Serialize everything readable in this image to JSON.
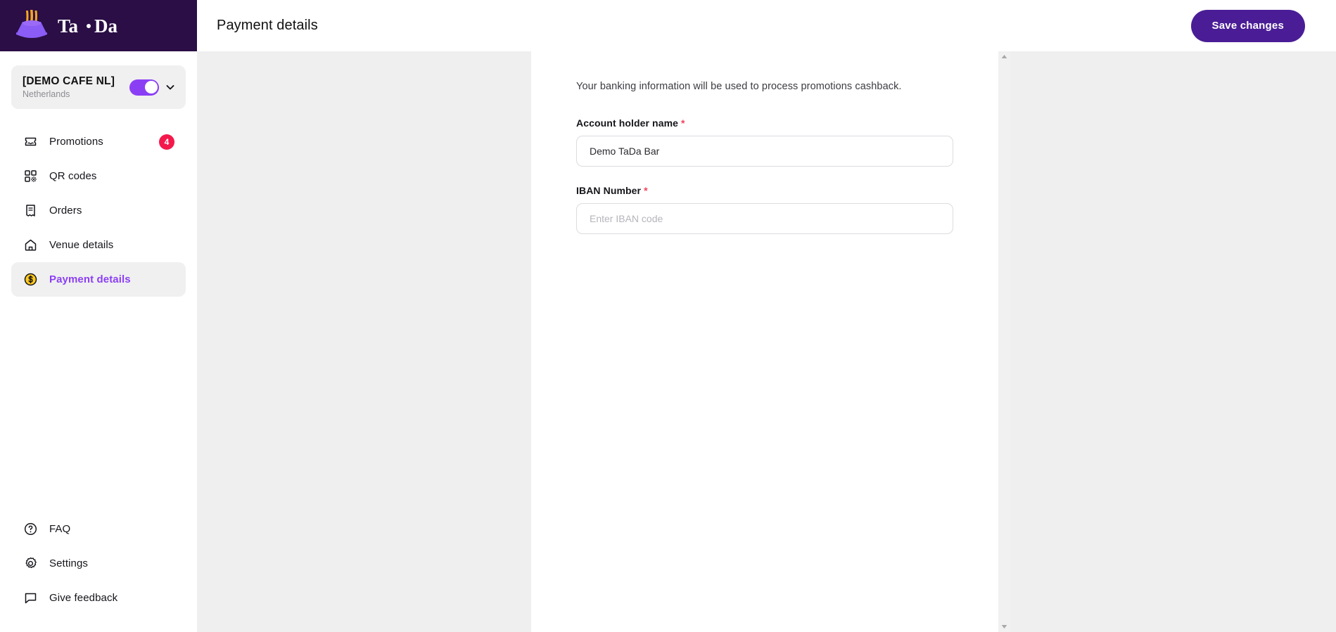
{
  "brand": {
    "logo_icon": "tada-hat-logo-icon",
    "wordmark": "Ta·Da",
    "logo_bar_color": "#2A0E45",
    "accent_purple": "#8B3FF5",
    "deep_purple": "#4A1D96",
    "badge_red": "#F4194B",
    "required_red": "#F4435C"
  },
  "sidebar": {
    "venue_selector": {
      "name": "[DEMO CAFE NL]",
      "country": "Netherlands",
      "toggle_on": true,
      "toggle_icon": "toggle-switch-on-icon",
      "chevron_icon": "chevron-down-icon"
    },
    "items": [
      {
        "label": "Promotions",
        "icon": "ticket-icon",
        "badge": "4",
        "active": false
      },
      {
        "label": "QR codes",
        "icon": "qr-code-icon",
        "badge": null,
        "active": false
      },
      {
        "label": "Orders",
        "icon": "receipt-icon",
        "badge": null,
        "active": false
      },
      {
        "label": "Venue details",
        "icon": "home-icon",
        "badge": null,
        "active": false
      },
      {
        "label": "Payment details",
        "icon": "dollar-coin-icon",
        "badge": null,
        "active": true
      }
    ],
    "bottom_items": [
      {
        "label": "FAQ",
        "icon": "question-circle-icon"
      },
      {
        "label": "Settings",
        "icon": "gear-icon"
      },
      {
        "label": "Give feedback",
        "icon": "chat-bubble-icon"
      }
    ]
  },
  "header": {
    "title": "Payment details",
    "save_label": "Save changes"
  },
  "main": {
    "intro": "Your banking information will be used to process promotions cashback.",
    "fields": [
      {
        "label": "Account holder name",
        "required_mark": "*",
        "value": "Demo TaDa Bar",
        "placeholder": ""
      },
      {
        "label": "IBAN Number",
        "required_mark": "*",
        "value": "",
        "placeholder": "Enter IBAN code"
      }
    ],
    "scrollbar": {
      "up_arrow_icon": "scroll-up-arrow-icon",
      "down_arrow_icon": "scroll-down-arrow-icon"
    }
  }
}
